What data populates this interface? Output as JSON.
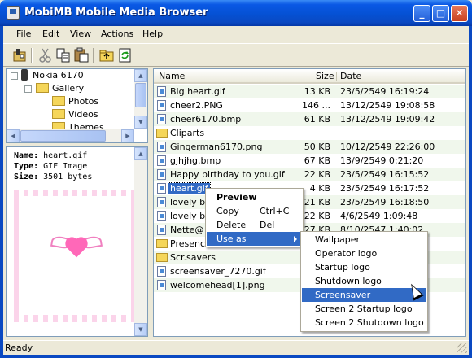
{
  "window": {
    "title": "MobiMB Mobile Media Browser"
  },
  "menu": [
    "File",
    "Edit",
    "View",
    "Actions",
    "Help"
  ],
  "toolbar_icons": [
    "phone-connect-icon",
    "cut-icon",
    "copy-icon",
    "paste-icon",
    "folder-up-icon",
    "refresh-icon"
  ],
  "tree": {
    "items": [
      {
        "label": "Nokia 6170",
        "icon": "phone-icon"
      },
      {
        "label": "Gallery",
        "icon": "folder-icon"
      },
      {
        "label": "Photos",
        "icon": "folder-icon"
      },
      {
        "label": "Videos",
        "icon": "folder-icon"
      },
      {
        "label": "Themes",
        "icon": "folder-icon"
      }
    ]
  },
  "info": {
    "name_label": "Name:",
    "name": "heart.gif",
    "type_label": "Type:",
    "type": "GIF Image",
    "size_label": "Size:",
    "size": "3501 bytes"
  },
  "list": {
    "columns": [
      "Name",
      "Size",
      "Date"
    ],
    "rows": [
      {
        "name": "Big heart.gif",
        "size": "13 KB",
        "date": "23/5/2549 16:19:24",
        "kind": "file"
      },
      {
        "name": "cheer2.PNG",
        "size": "146 ...",
        "date": "13/12/2549 19:08:58",
        "kind": "file"
      },
      {
        "name": "cheer6170.bmp",
        "size": "61 KB",
        "date": "13/12/2549 19:09:42",
        "kind": "file"
      },
      {
        "name": "Cliparts",
        "size": "",
        "date": "",
        "kind": "folder"
      },
      {
        "name": "Gingerman6170.png",
        "size": "50 KB",
        "date": "10/12/2549 22:26:00",
        "kind": "file"
      },
      {
        "name": "gjhjhg.bmp",
        "size": "67 KB",
        "date": "13/9/2549 0:21:20",
        "kind": "file"
      },
      {
        "name": "Happy birthday to you.gif",
        "size": "22 KB",
        "date": "23/5/2549 16:15:52",
        "kind": "file"
      },
      {
        "name": "heart.gif",
        "size": "4 KB",
        "date": "23/5/2549 16:17:52",
        "kind": "file",
        "selected": true
      },
      {
        "name": "lovely be",
        "size": "21 KB",
        "date": "23/5/2549 16:18:50",
        "kind": "file"
      },
      {
        "name": "lovely be",
        "size": "22 KB",
        "date": "4/6/2549 1:09:48",
        "kind": "file"
      },
      {
        "name": "Nette@",
        "size": "27 KB",
        "date": "8/10/2547 1:40:02",
        "kind": "file"
      },
      {
        "name": "Presenc",
        "size": "",
        "date": "",
        "kind": "folder"
      },
      {
        "name": "Scr.savers",
        "size": "",
        "date": "",
        "kind": "folder"
      },
      {
        "name": "screensaver_7270.gif",
        "size": "",
        "date": "",
        "kind": "file"
      },
      {
        "name": "welcomehead[1].png",
        "size": "",
        "date": "",
        "kind": "file"
      }
    ]
  },
  "context_menu": {
    "items": [
      {
        "label": "Preview",
        "shortcut": ""
      },
      {
        "label": "Copy",
        "shortcut": "Ctrl+C"
      },
      {
        "label": "Delete",
        "shortcut": "Del"
      },
      {
        "label": "Use as",
        "shortcut": ""
      }
    ]
  },
  "submenu": {
    "items": [
      "Wallpaper",
      "Operator logo",
      "Startup logo",
      "Shutdown logo",
      "Screensaver",
      "Screen 2 Startup logo",
      "Screen 2 Shutdown logo"
    ],
    "highlighted": "Screensaver"
  },
  "status": {
    "text": "Ready"
  },
  "colors": {
    "selection": "#316ac5",
    "titlebar": "#0551d4",
    "row_alt": "#f0f7ec"
  }
}
